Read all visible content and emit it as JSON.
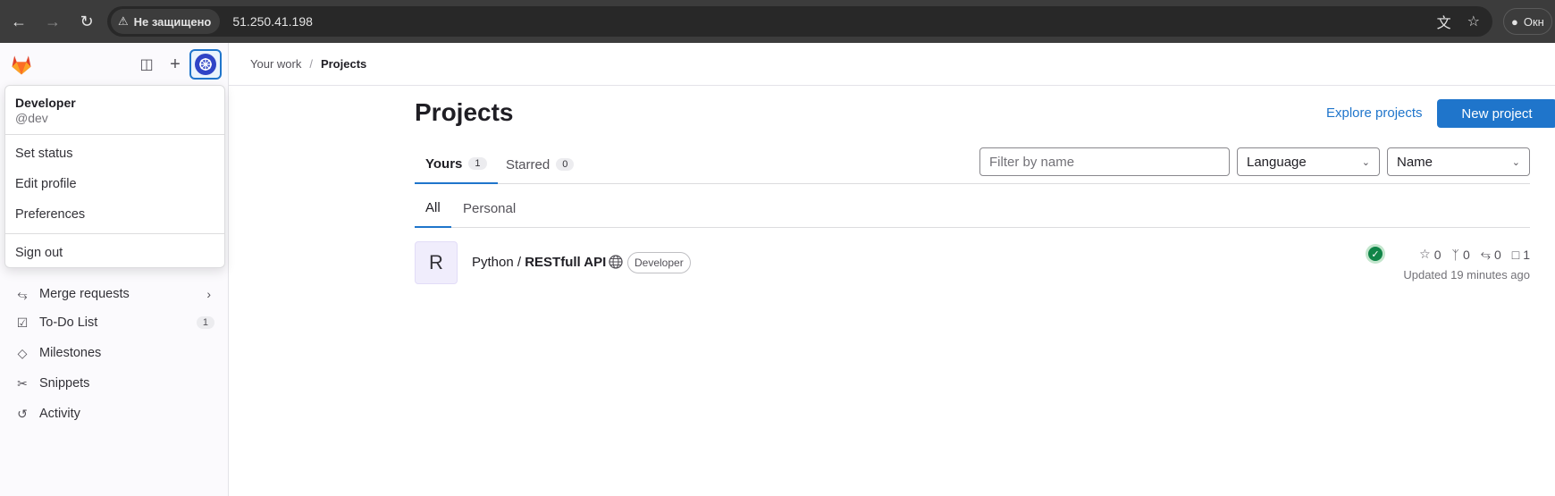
{
  "browser": {
    "security_label": "Не защищено",
    "url": "51.250.41.198",
    "profile_label": "Окн"
  },
  "breadcrumb": {
    "parent": "Your work",
    "current": "Projects"
  },
  "sidebar": {
    "items": [
      {
        "label": "Merge requests",
        "icon": "merge-request-icon"
      },
      {
        "label": "To-Do List",
        "icon": "todo-icon",
        "count": "1"
      },
      {
        "label": "Milestones",
        "icon": "milestone-icon"
      },
      {
        "label": "Snippets",
        "icon": "snippet-icon"
      },
      {
        "label": "Activity",
        "icon": "history-icon"
      }
    ]
  },
  "user_menu": {
    "name": "Developer",
    "handle": "@dev",
    "items": [
      "Set status",
      "Edit profile",
      "Preferences"
    ],
    "sign_out": "Sign out"
  },
  "main": {
    "title": "Projects",
    "explore_link": "Explore projects",
    "new_project": "New project",
    "tabs": [
      {
        "label": "Yours",
        "count": "1",
        "active": true
      },
      {
        "label": "Starred",
        "count": "0",
        "active": false
      }
    ],
    "filter_placeholder": "Filter by name",
    "language_select": "Language",
    "sort_select": "Name",
    "subtabs": [
      {
        "label": "All",
        "active": true
      },
      {
        "label": "Personal",
        "active": false
      }
    ]
  },
  "project": {
    "avatar_letter": "R",
    "namespace": "Python / ",
    "name": "RESTfull API",
    "role": "Developer",
    "stars": "0",
    "forks": "0",
    "merge_requests": "0",
    "issues": "1",
    "updated": "Updated 19 minutes ago"
  },
  "colors": {
    "accent": "#1f75cb",
    "success": "#108548",
    "avatar_bg": "#2f44c6"
  }
}
